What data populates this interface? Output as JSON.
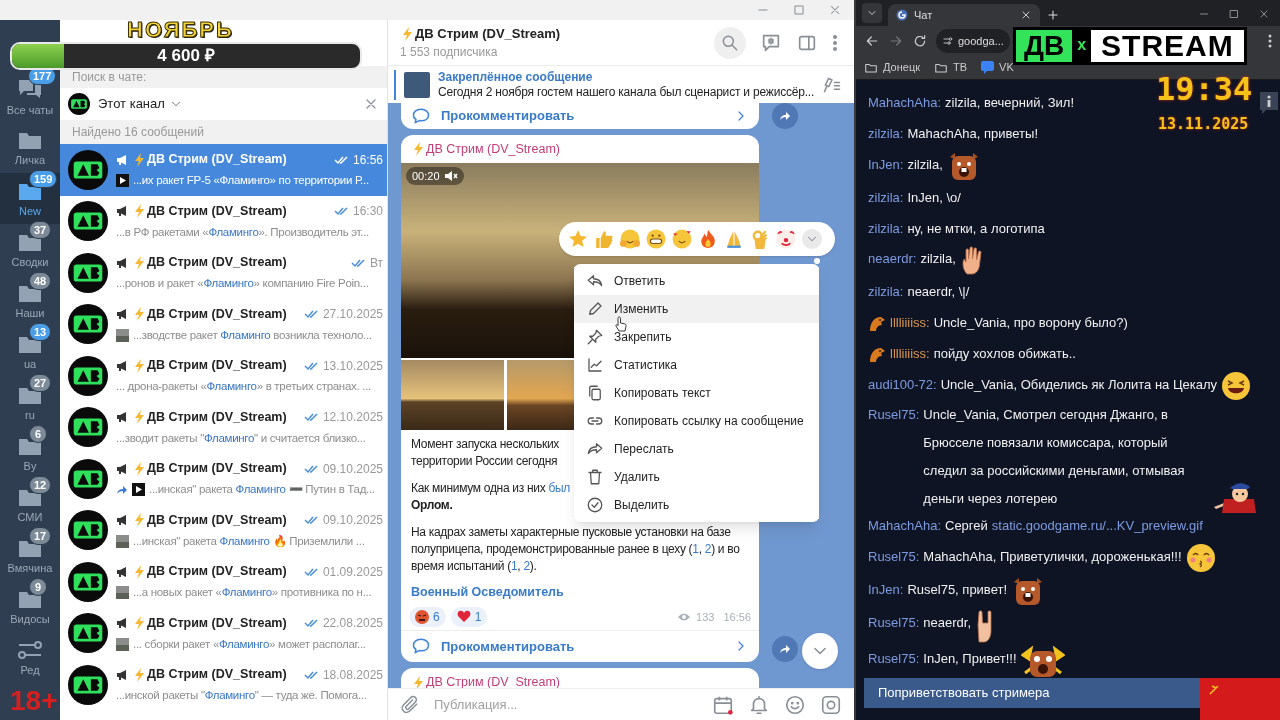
{
  "goal": {
    "title": "НОЯБРЬ",
    "amount": "4 600 ₽",
    "level": 0.15
  },
  "logo": {
    "mark": "ДВ",
    "joiner": "x",
    "word": "STREAM"
  },
  "clock": {
    "time": "19:34",
    "date": "13.11.2025"
  },
  "age_rating": "18+",
  "telegram": {
    "folders": [
      {
        "kind": "chats",
        "label": "Все чаты",
        "badge": "177",
        "muted": false,
        "selected": false
      },
      {
        "kind": "folder",
        "label": "Личка",
        "selected": false
      },
      {
        "kind": "folder",
        "label": "New",
        "badge": "159",
        "muted": false,
        "selected": true
      },
      {
        "kind": "folder",
        "label": "Сводки",
        "badge": "37",
        "muted": true,
        "selected": false
      },
      {
        "kind": "folder",
        "label": "Наши",
        "badge": "48",
        "muted": true,
        "selected": false
      },
      {
        "kind": "folder",
        "label": "ua",
        "badge": "13",
        "muted": false,
        "selected": false
      },
      {
        "kind": "folder",
        "label": "ru",
        "badge": "27",
        "muted": true,
        "selected": false
      },
      {
        "kind": "folder",
        "label": "By",
        "badge": "6",
        "muted": true,
        "selected": false
      },
      {
        "kind": "folder",
        "label": "СМИ",
        "badge": "12",
        "muted": true,
        "selected": false
      },
      {
        "kind": "folder",
        "label": "Вмячина",
        "badge": "17",
        "muted": true,
        "selected": false
      },
      {
        "kind": "folder",
        "label": "Видосы",
        "badge": "9",
        "muted": true,
        "selected": false
      },
      {
        "kind": "edit",
        "label": "Ред",
        "selected": false
      }
    ],
    "search": {
      "scope_label": "Поиск в чате:",
      "scope": "Этот канал",
      "found": "Найдено 16 сообщений"
    },
    "results": [
      {
        "kind": "video",
        "name": "ДВ Стрим (DV_Stream)",
        "date": "16:56",
        "forwarded": false,
        "before": "...их ракет FP-5 «",
        "match": "Фламинго",
        "after": "» по территории Р...",
        "selected": true
      },
      {
        "kind": "text",
        "name": "ДВ Стрим (DV_Stream)",
        "date": "16:30",
        "forwarded": false,
        "before": "...в РФ ракетами «",
        "match": "Фламинго",
        "after": "».  Производитель эт...",
        "selected": false
      },
      {
        "kind": "text",
        "name": "ДВ Стрим (DV_Stream)",
        "date": "Вт",
        "forwarded": false,
        "before": "...ронов и ракет «",
        "match": "Фламинго",
        "after": "» компанию Fire Poin...",
        "selected": false
      },
      {
        "kind": "photo",
        "name": "ДВ Стрим (DV_Stream)",
        "date": "27.10.2025",
        "forwarded": false,
        "before": "...зводстве ракет ",
        "match": "Фламинго",
        "after": " возникла техноло...",
        "selected": false
      },
      {
        "kind": "text",
        "name": "ДВ Стрим (DV_Stream)",
        "date": "13.10.2025",
        "forwarded": false,
        "before": "... дрона-ракеты «",
        "match": "Фламинго",
        "after": "» в третьих странах. ...",
        "selected": false
      },
      {
        "kind": "text",
        "name": "ДВ Стрим (DV_Stream)",
        "date": "12.10.2025",
        "forwarded": false,
        "before": "...зводит ракеты \"",
        "match": "Фламинго",
        "after": "\" и считается близко...",
        "selected": false
      },
      {
        "kind": "video",
        "name": "ДВ Стрим (DV_Stream)",
        "date": "09.10.2025",
        "forwarded": true,
        "before": "...инская\" ракета ",
        "match": "Фламинго",
        "after": " ➖ Путин в Тад...",
        "selected": false
      },
      {
        "kind": "photo",
        "name": "ДВ Стрим (DV_Stream)",
        "date": "09.10.2025",
        "forwarded": false,
        "before": "...инская\" ракета ",
        "match": "Фламинго",
        "after": " 🔥 Приземлили ...",
        "selected": false
      },
      {
        "kind": "photo",
        "name": "ДВ Стрим (DV_Stream)",
        "date": "01.09.2025",
        "forwarded": false,
        "before": "...а новых ракет «",
        "match": "Фламинго",
        "after": "» противника по н...",
        "selected": false
      },
      {
        "kind": "photo",
        "name": "ДВ Стрим (DV_Stream)",
        "date": "22.08.2025",
        "forwarded": false,
        "before": "... сборки ракет «",
        "match": "Фламинго",
        "after": "» может располаг...",
        "selected": false
      },
      {
        "kind": "text",
        "name": "ДВ Стрим (DV_Stream)",
        "date": "18.08.2025",
        "forwarded": false,
        "before": "...инской ракеты \"",
        "match": "Фламинго",
        "after": "\" — туда же. Помога...",
        "selected": false
      }
    ],
    "channel": {
      "title": "ДВ Стрим (DV_Stream)",
      "subscribers": "1 553 подписчика"
    },
    "pinned": {
      "label": "Закреплённое сообщение",
      "text": "Сегодня 2 ноября гостем нашего канала был сценарист и режиссёр..."
    },
    "prev_comment": "Прокомментировать",
    "post": {
      "author": "ДВ Стрим (DV_Stream)",
      "duration": "00:20",
      "paragraphs": [
        [
          [
            {
              "kind": "plain",
              "text": "Момент запуска нескольких"
            }
          ],
          [
            {
              "kind": "plain",
              "text": "территории России сегодня"
            }
          ]
        ],
        [
          [
            {
              "kind": "plain",
              "text": "Как минимум одна из них "
            },
            {
              "kind": "link",
              "text": "был"
            }
          ],
          [
            {
              "kind": "bold",
              "text": "Орлом."
            }
          ]
        ],
        [
          [
            {
              "kind": "plain",
              "text": "На кадрах заметы характерные пусковые установки на базе"
            }
          ],
          [
            {
              "kind": "plain",
              "text": "полуприцепа, продемонстрированные ранее в цеху ("
            },
            {
              "kind": "link",
              "text": "1"
            },
            {
              "kind": "plain",
              "text": ", "
            },
            {
              "kind": "link",
              "text": "2"
            },
            {
              "kind": "plain",
              "text": ") и во"
            }
          ],
          [
            {
              "kind": "plain",
              "text": "время испытаний ("
            },
            {
              "kind": "link",
              "text": "1"
            },
            {
              "kind": "plain",
              "text": ", "
            },
            {
              "kind": "link",
              "text": "2"
            },
            {
              "kind": "plain",
              "text": ")."
            }
          ]
        ]
      ],
      "signature": "Военный Осведомитель",
      "reactions": [
        {
          "kind": "angry",
          "count": "6"
        },
        {
          "kind": "heart",
          "count": "1"
        }
      ],
      "views": "133",
      "time": "16:56",
      "comment": "Прокомментировать"
    },
    "next_author": "ДВ Стрим (DV_Stream)",
    "composer": {
      "placeholder": "Публикация..."
    },
    "menu": [
      {
        "kind": "reply",
        "label": "Ответить",
        "selected": false
      },
      {
        "kind": "edit",
        "label": "Изменить",
        "selected": true
      },
      {
        "kind": "pin",
        "label": "Закрепить",
        "selected": false
      },
      {
        "kind": "stats",
        "label": "Статистика",
        "selected": false
      },
      {
        "kind": "copy",
        "label": "Копировать текст",
        "selected": false
      },
      {
        "kind": "link",
        "label": "Копировать ссылку на сообщение",
        "selected": false
      },
      {
        "kind": "forward",
        "label": "Переслать",
        "selected": false
      },
      {
        "kind": "delete",
        "label": "Удалить",
        "selected": false
      },
      {
        "kind": "select",
        "label": "Выделить",
        "selected": false
      }
    ]
  },
  "browser": {
    "tab": "Чат",
    "address": "goodga...",
    "bookmarks": [
      {
        "kind": "folder",
        "label": "Донецк"
      },
      {
        "kind": "folder",
        "label": "ТВ"
      },
      {
        "kind": "app",
        "label": "VK"
      }
    ],
    "chat": [
      {
        "user": "MahachAha:",
        "color": "#7d9be0",
        "badge": false,
        "text": "zilzila, вечерний, Зил!"
      },
      {
        "user": "zilzila:",
        "color": "#7d9be0",
        "badge": false,
        "text": "MahachAha, приветы!"
      },
      {
        "user": "InJen:",
        "color": "#7d9be0",
        "badge": false,
        "text": "zilzila,",
        "kind": "beaver"
      },
      {
        "user": "zilzila:",
        "color": "#7d9be0",
        "badge": false,
        "text": "InJen, \\o/"
      },
      {
        "user": "zilzila:",
        "color": "#7d9be0",
        "badge": false,
        "text": "ну, не мтки, а логотипа"
      },
      {
        "user": "neaerdr:",
        "color": "#7d9be0",
        "badge": false,
        "text": "zilzila,",
        "kind": "hand"
      },
      {
        "user": "zilzila:",
        "color": "#7d9be0",
        "badge": false,
        "text": "neaerdr, \\|/"
      },
      {
        "user": "lllliiiiss:",
        "color": "#d9964e",
        "badge": true,
        "text": "Uncle_Vania, про ворону было?)"
      },
      {
        "user": "lllliiiiss:",
        "color": "#d9964e",
        "badge": true,
        "text": "пойду хохлов обижать.."
      },
      {
        "user": "audi100-72:",
        "color": "#7d9be0",
        "badge": false,
        "text": "Uncle_Vania, Обиделись як Лолита на Цекалу",
        "kind": "laugh"
      },
      {
        "user": "Rusel75:",
        "color": "#7d9be0",
        "badge": false,
        "text": "Uncle_Vania, Смотрел сегодня Джанго, в Брюсселе повязали комиссара, который следил за российскими деньгами, отмывая деньги через лотерею",
        "kind": "figure"
      },
      {
        "user": "MahachAha:",
        "color": "#7d9be0",
        "badge": false,
        "text": "Сергей",
        "link": "static.goodgame.ru/...KV_preview.gif"
      },
      {
        "user": "Rusel75:",
        "color": "#7d9be0",
        "badge": false,
        "text": "MahachAha, Приветулички, дороженькая!!!",
        "kind": "kiss"
      },
      {
        "user": "InJen:",
        "color": "#7d9be0",
        "badge": false,
        "text": "Rusel75, привет!",
        "kind": "beaver"
      },
      {
        "user": "Rusel75:",
        "color": "#7d9be0",
        "badge": false,
        "text": "neaerdr,",
        "kind": "rock"
      },
      {
        "user": "Rusel75:",
        "color": "#7d9be0",
        "badge": false,
        "text": "InJen, Привет!!!",
        "kind": "shock"
      }
    ],
    "greet_button": "Поприветствовать стримера"
  }
}
